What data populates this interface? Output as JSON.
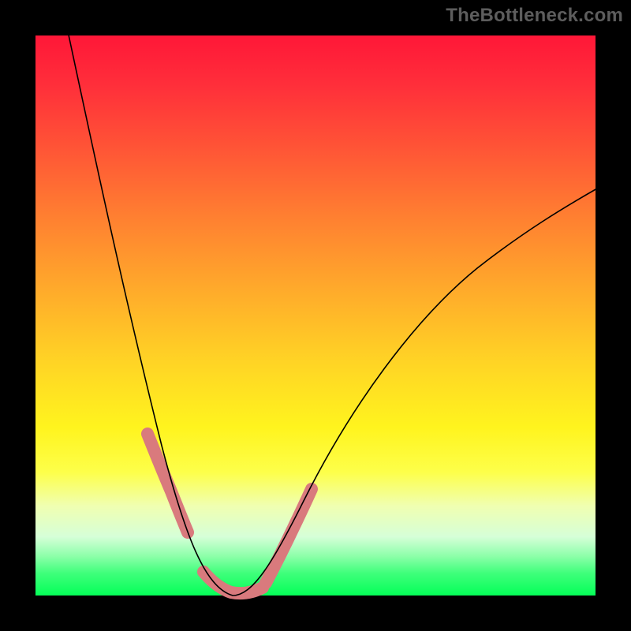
{
  "watermark": "TheBottleneck.com",
  "chart_data": {
    "type": "line",
    "title": "",
    "xlabel": "",
    "ylabel": "",
    "xlim": [
      0,
      100
    ],
    "ylim": [
      0,
      100
    ],
    "grid": false,
    "legend": false,
    "series": [
      {
        "name": "curve",
        "x": [
          5,
          8,
          12,
          16,
          20,
          24,
          27,
          29,
          31,
          33,
          35,
          38,
          44,
          52,
          60,
          68,
          76,
          84,
          92,
          100
        ],
        "y": [
          100,
          80,
          58,
          42,
          30,
          18,
          12,
          8,
          5,
          2,
          0,
          4,
          14,
          28,
          40,
          50,
          58,
          64,
          69,
          73
        ]
      }
    ],
    "highlight_bands": [
      {
        "x_range": [
          19,
          26
        ],
        "side": "left"
      },
      {
        "x_range": [
          30,
          40
        ],
        "side": "bottom"
      },
      {
        "x_range": [
          40,
          48
        ],
        "side": "right"
      }
    ],
    "background_gradient": {
      "stops": [
        {
          "pos": 0.0,
          "color": "#ff1738"
        },
        {
          "pos": 0.2,
          "color": "#ff5436"
        },
        {
          "pos": 0.45,
          "color": "#ffa92b"
        },
        {
          "pos": 0.7,
          "color": "#fff41e"
        },
        {
          "pos": 0.85,
          "color": "#f0ffb1"
        },
        {
          "pos": 1.0,
          "color": "#05ff58"
        }
      ]
    }
  }
}
